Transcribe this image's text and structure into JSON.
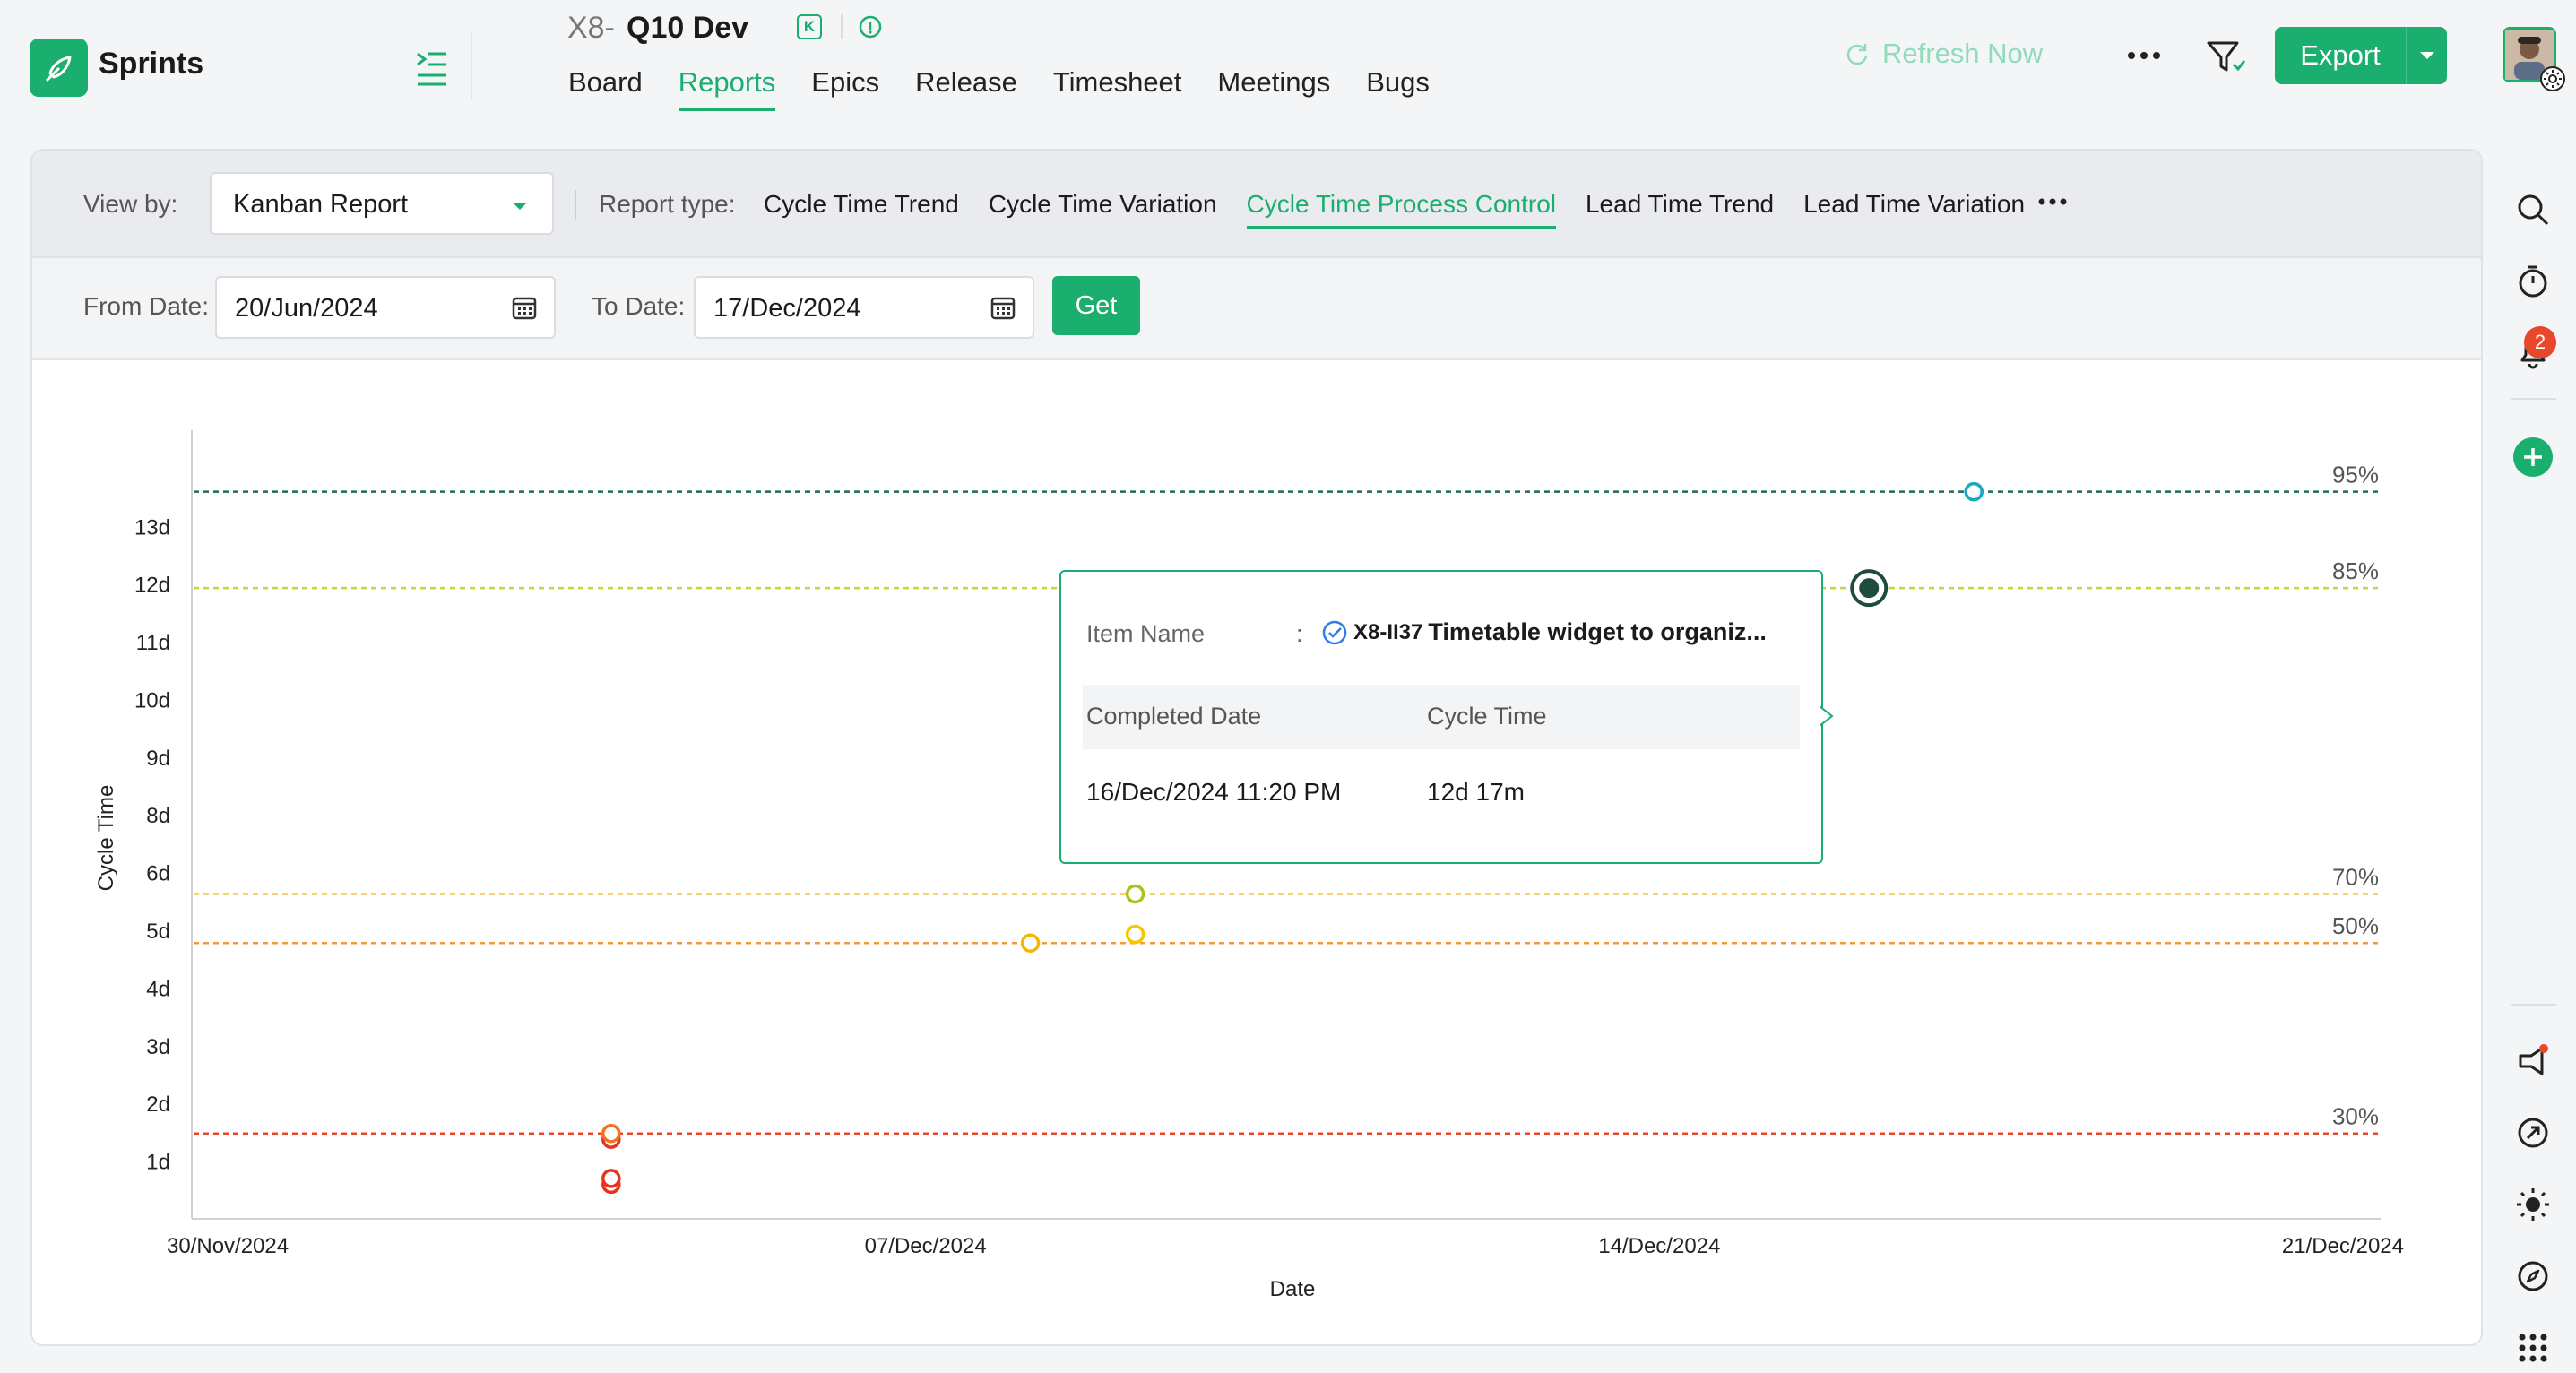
{
  "app": {
    "name": "Sprints"
  },
  "project": {
    "prefix": "X8-",
    "name": "Q10 Dev",
    "badge": "K"
  },
  "nav": {
    "tabs": [
      {
        "label": "Board"
      },
      {
        "label": "Reports"
      },
      {
        "label": "Epics"
      },
      {
        "label": "Release"
      },
      {
        "label": "Timesheet"
      },
      {
        "label": "Meetings"
      },
      {
        "label": "Bugs"
      }
    ],
    "active": "Reports"
  },
  "toolbar": {
    "refresh_label": "Refresh Now",
    "export_label": "Export"
  },
  "notifications": {
    "count": "2"
  },
  "filters": {
    "view_by_label": "View by:",
    "view_by_value": "Kanban Report",
    "report_type_label": "Report type:",
    "report_types": [
      {
        "label": "Cycle Time Trend"
      },
      {
        "label": "Cycle Time Variation"
      },
      {
        "label": "Cycle Time Process Control"
      },
      {
        "label": "Lead Time Trend"
      },
      {
        "label": "Lead Time Variation"
      }
    ],
    "active_report_type": "Cycle Time Process Control",
    "from_date_label": "From Date:",
    "from_date_value": "20/Jun/2024",
    "to_date_label": "To Date:",
    "to_date_value": "17/Dec/2024",
    "get_label": "Get"
  },
  "chart_data": {
    "type": "scatter",
    "ylabel": "Cycle Time",
    "xlabel": "Date",
    "y_unit": "days",
    "ylim": [
      0,
      13.2
    ],
    "y_ticks": [
      "1d",
      "2d",
      "3d",
      "4d",
      "5d",
      "6d",
      "8d",
      "9d",
      "10d",
      "11d",
      "12d",
      "13d"
    ],
    "y_tick_values": [
      1,
      2,
      3,
      4,
      5,
      6,
      7,
      8,
      9,
      10,
      11,
      12
    ],
    "x_ticks": [
      "30/Nov/2024",
      "07/Dec/2024",
      "14/Dec/2024",
      "21/Dec/2024"
    ],
    "xlim": [
      "2024-11-30",
      "2024-12-21"
    ],
    "percentile_lines": [
      {
        "label": "95%",
        "value": 12.6,
        "color": "#1f6b5a"
      },
      {
        "label": "85%",
        "value": 10.93,
        "color": "#c8d63a"
      },
      {
        "label": "70%",
        "value": 5.63,
        "color": "#f5c242"
      },
      {
        "label": "50%",
        "value": 4.78,
        "color": "#f2993a"
      },
      {
        "label": "30%",
        "value": 1.48,
        "color": "#e8472a"
      }
    ],
    "points": [
      {
        "date": "2024-12-04",
        "value": 1.38,
        "color": "#e8321f"
      },
      {
        "date": "2024-12-04",
        "value": 1.48,
        "color": "#f2731f"
      },
      {
        "date": "2024-12-04",
        "value": 0.6,
        "color": "#e8321f"
      },
      {
        "date": "2024-12-04",
        "value": 0.7,
        "color": "#e8321f"
      },
      {
        "date": "2024-12-08",
        "value": 4.78,
        "color": "#f5b800"
      },
      {
        "date": "2024-12-09",
        "value": 5.63,
        "color": "#a9c41a"
      },
      {
        "date": "2024-12-09",
        "value": 4.93,
        "color": "#f5c800"
      },
      {
        "date": "2024-12-10",
        "value": 6.48,
        "color": "#8cc11a"
      },
      {
        "date": "2024-12-16",
        "value": 10.93,
        "color": "#1f4d3d",
        "selected": true
      },
      {
        "date": "2024-12-17",
        "value": 12.6,
        "color": "#1aa7c4"
      }
    ],
    "tooltip": {
      "item_name_label": "Item Name",
      "item_id": "X8-II37",
      "item_title": "Timetable widget to organiz...",
      "completed_date_label": "Completed Date",
      "cycle_time_label": "Cycle Time",
      "completed_date_value": "16/Dec/2024 11:20 PM",
      "cycle_time_value": "12d 17m"
    }
  }
}
